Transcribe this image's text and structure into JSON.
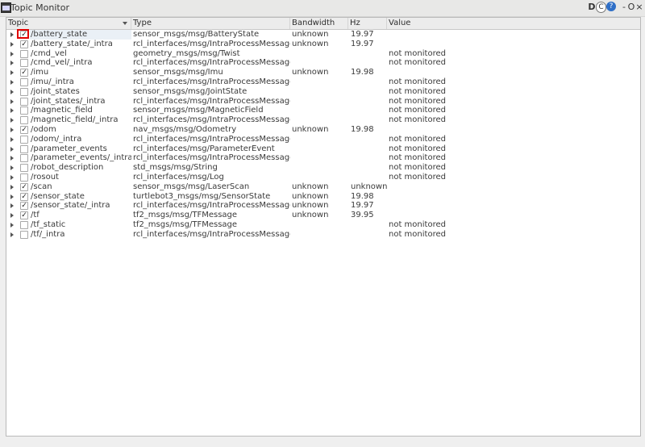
{
  "window": {
    "title": "Topic Monitor",
    "buttons": {
      "d": "D",
      "c": "C",
      "q": "?",
      "min": "-",
      "max": "O",
      "close": "×"
    }
  },
  "columns": {
    "topic": "Topic",
    "type": "Type",
    "bandwidth": "Bandwidth",
    "hz": "Hz",
    "value": "Value"
  },
  "rows": [
    {
      "topic": "/battery_state",
      "type": "sensor_msgs/msg/BatteryState",
      "bandwidth": "unknown",
      "hz": "19.97",
      "value": "",
      "checked": true
    },
    {
      "topic": "/battery_state/_intra",
      "type": "rcl_interfaces/msg/IntraProcessMessage",
      "bandwidth": "unknown",
      "hz": "19.97",
      "value": "",
      "checked": true
    },
    {
      "topic": "/cmd_vel",
      "type": "geometry_msgs/msg/Twist",
      "bandwidth": "",
      "hz": "",
      "value": "not monitored",
      "checked": false
    },
    {
      "topic": "/cmd_vel/_intra",
      "type": "rcl_interfaces/msg/IntraProcessMessage",
      "bandwidth": "",
      "hz": "",
      "value": "not monitored",
      "checked": false
    },
    {
      "topic": "/imu",
      "type": "sensor_msgs/msg/Imu",
      "bandwidth": "unknown",
      "hz": "19.98",
      "value": "",
      "checked": true
    },
    {
      "topic": "/imu/_intra",
      "type": "rcl_interfaces/msg/IntraProcessMessage",
      "bandwidth": "",
      "hz": "",
      "value": "not monitored",
      "checked": false
    },
    {
      "topic": "/joint_states",
      "type": "sensor_msgs/msg/JointState",
      "bandwidth": "",
      "hz": "",
      "value": "not monitored",
      "checked": false
    },
    {
      "topic": "/joint_states/_intra",
      "type": "rcl_interfaces/msg/IntraProcessMessage",
      "bandwidth": "",
      "hz": "",
      "value": "not monitored",
      "checked": false
    },
    {
      "topic": "/magnetic_field",
      "type": "sensor_msgs/msg/MagneticField",
      "bandwidth": "",
      "hz": "",
      "value": "not monitored",
      "checked": false
    },
    {
      "topic": "/magnetic_field/_intra",
      "type": "rcl_interfaces/msg/IntraProcessMessage",
      "bandwidth": "",
      "hz": "",
      "value": "not monitored",
      "checked": false
    },
    {
      "topic": "/odom",
      "type": "nav_msgs/msg/Odometry",
      "bandwidth": "unknown",
      "hz": "19.98",
      "value": "",
      "checked": true
    },
    {
      "topic": "/odom/_intra",
      "type": "rcl_interfaces/msg/IntraProcessMessage",
      "bandwidth": "",
      "hz": "",
      "value": "not monitored",
      "checked": false
    },
    {
      "topic": "/parameter_events",
      "type": "rcl_interfaces/msg/ParameterEvent",
      "bandwidth": "",
      "hz": "",
      "value": "not monitored",
      "checked": false
    },
    {
      "topic": "/parameter_events/_intra",
      "type": "rcl_interfaces/msg/IntraProcessMessage",
      "bandwidth": "",
      "hz": "",
      "value": "not monitored",
      "checked": false
    },
    {
      "topic": "/robot_description",
      "type": "std_msgs/msg/String",
      "bandwidth": "",
      "hz": "",
      "value": "not monitored",
      "checked": false
    },
    {
      "topic": "/rosout",
      "type": "rcl_interfaces/msg/Log",
      "bandwidth": "",
      "hz": "",
      "value": "not monitored",
      "checked": false
    },
    {
      "topic": "/scan",
      "type": "sensor_msgs/msg/LaserScan",
      "bandwidth": "unknown",
      "hz": "unknown",
      "value": "",
      "checked": true
    },
    {
      "topic": "/sensor_state",
      "type": "turtlebot3_msgs/msg/SensorState",
      "bandwidth": "unknown",
      "hz": "19.98",
      "value": "",
      "checked": true
    },
    {
      "topic": "/sensor_state/_intra",
      "type": "rcl_interfaces/msg/IntraProcessMessage",
      "bandwidth": "unknown",
      "hz": "19.97",
      "value": "",
      "checked": true
    },
    {
      "topic": "/tf",
      "type": "tf2_msgs/msg/TFMessage",
      "bandwidth": "unknown",
      "hz": "39.95",
      "value": "",
      "checked": true
    },
    {
      "topic": "/tf_static",
      "type": "tf2_msgs/msg/TFMessage",
      "bandwidth": "",
      "hz": "",
      "value": "not monitored",
      "checked": false
    },
    {
      "topic": "/tf/_intra",
      "type": "rcl_interfaces/msg/IntraProcessMessage",
      "bandwidth": "",
      "hz": "",
      "value": "not monitored",
      "checked": false
    }
  ],
  "check_glyph": "✓",
  "colors": {
    "highlight": "#e00000",
    "selection": "#eaf0f6"
  }
}
